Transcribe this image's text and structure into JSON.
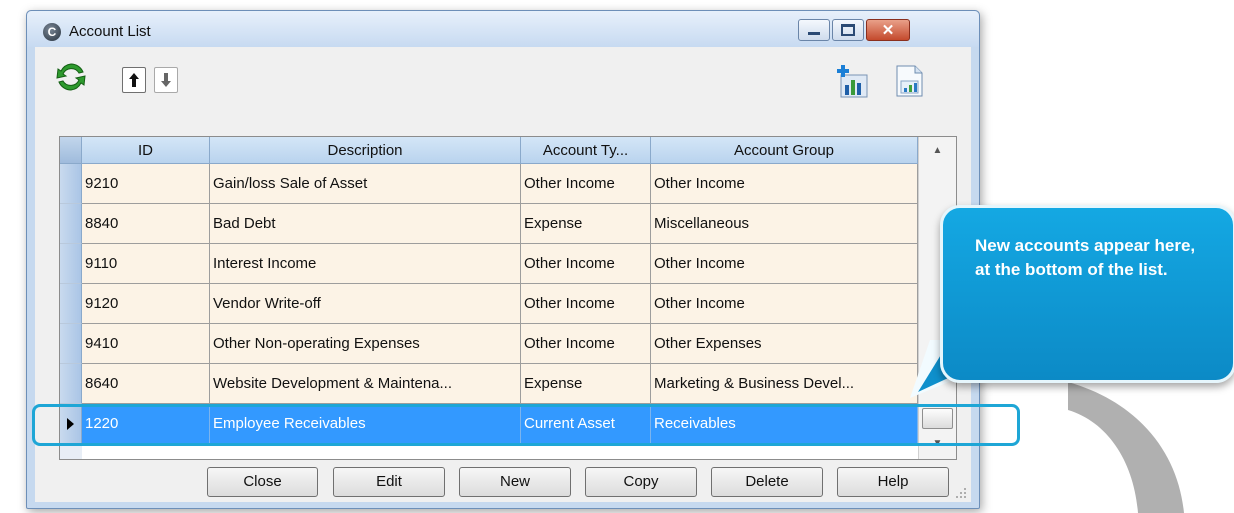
{
  "window": {
    "title": "Account List",
    "app_icon_glyph": "C"
  },
  "toolbar": {
    "icons": [
      "refresh-icon",
      "arrow-up-icon",
      "arrow-down-icon",
      "add-report-icon",
      "export-report-icon"
    ]
  },
  "grid": {
    "columns": [
      "ID",
      "Description",
      "Account Ty...",
      "Account Group"
    ],
    "rows": [
      {
        "id": "9210",
        "description": "Gain/loss Sale of Asset",
        "type": "Other Income",
        "group": "Other Income"
      },
      {
        "id": "8840",
        "description": "Bad Debt",
        "type": "Expense",
        "group": "Miscellaneous"
      },
      {
        "id": "9110",
        "description": "Interest Income",
        "type": "Other Income",
        "group": "Other Income"
      },
      {
        "id": "9120",
        "description": "Vendor Write-off",
        "type": "Other Income",
        "group": "Other Income"
      },
      {
        "id": "9410",
        "description": "Other Non-operating Expenses",
        "type": "Other Income",
        "group": "Other Expenses"
      },
      {
        "id": "8640",
        "description": "Website Development & Maintena...",
        "type": "Expense",
        "group": "Marketing & Business Devel..."
      },
      {
        "id": "1220",
        "description": "Employee Receivables",
        "type": "Current Asset",
        "group": "Receivables",
        "selected": true
      }
    ]
  },
  "buttons": {
    "close": "Close",
    "edit": "Edit",
    "new": "New",
    "copy": "Copy",
    "delete": "Delete",
    "help": "Help"
  },
  "callout": {
    "text": "New accounts appear here, at the bottom of the list."
  },
  "colors": {
    "row_background": "#fcf3e6",
    "selected_row": "#3399ff",
    "highlight": "#1ea6d6",
    "callout": "#0c8ac6"
  }
}
